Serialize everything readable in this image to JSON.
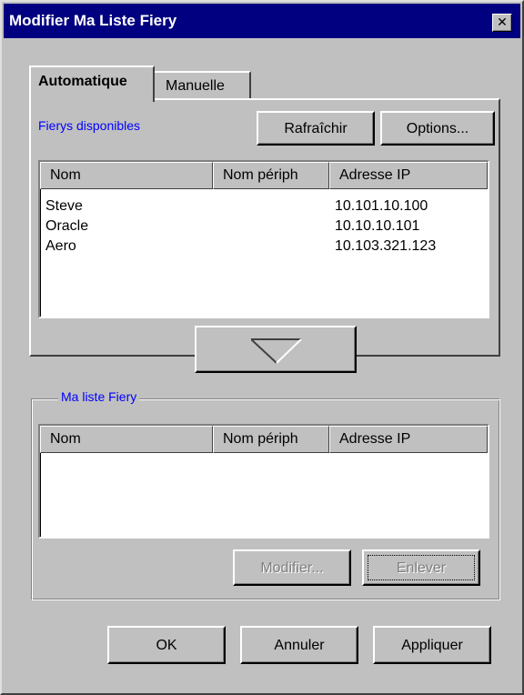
{
  "window": {
    "title": "Modifier Ma Liste Fiery",
    "close_glyph": "✕"
  },
  "tabs": [
    {
      "label": "Automatique",
      "active": true
    },
    {
      "label": "Manuelle",
      "active": false
    }
  ],
  "available": {
    "label": "Fierys disponibles",
    "refresh_label": "Rafraîchir",
    "options_label": "Options...",
    "columns": [
      "Nom",
      "Nom périph",
      "Adresse IP"
    ],
    "rows": [
      {
        "name": "Steve",
        "device": "",
        "ip": "10.101.10.100"
      },
      {
        "name": "Oracle",
        "device": "",
        "ip": "10.10.10.101"
      },
      {
        "name": "Aero",
        "device": "",
        "ip": "10.103.321.123"
      }
    ]
  },
  "add_button_icon": "down-arrow-icon",
  "my_list": {
    "label": "Ma liste Fiery",
    "columns": [
      "Nom",
      "Nom périph",
      "Adresse IP"
    ],
    "rows": [],
    "modify_label": "Modifier...",
    "remove_label": "Enlever"
  },
  "footer": {
    "ok_label": "OK",
    "cancel_label": "Annuler",
    "apply_label": "Appliquer"
  },
  "colors": {
    "titlebar": "#000080",
    "face": "#c0c0c0",
    "label_blue": "#0000ff"
  }
}
